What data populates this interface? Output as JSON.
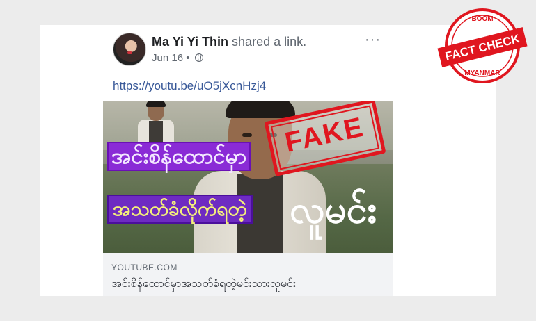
{
  "post": {
    "author": "Ma Yi Yi Thin",
    "action": "shared a link.",
    "date": "Jun 16",
    "separator": "•",
    "more": "···",
    "link_url": "https://youtu.be/uO5jXcnHzj4"
  },
  "preview": {
    "thumbnail_text_1": "အင်းစိန်ထောင်မှာ",
    "thumbnail_text_2": "အသတ်ခံလိုက်ရတဲ့",
    "thumbnail_text_3": "လူမင်း",
    "stamp": "FAKE",
    "domain": "YOUTUBE.COM",
    "title": "အင်းစိန်ထောင်မှာအသတ်ခံရတဲ့မင်းသားလူမင်း"
  },
  "badge": {
    "top": "BOOM",
    "main": "FACT CHECK",
    "bottom": "MYANMAR"
  },
  "colors": {
    "link": "#385898",
    "stamp": "#e0161f",
    "badge": "#e0161f"
  },
  "icons": [
    "globe-icon",
    "more-options-icon"
  ]
}
